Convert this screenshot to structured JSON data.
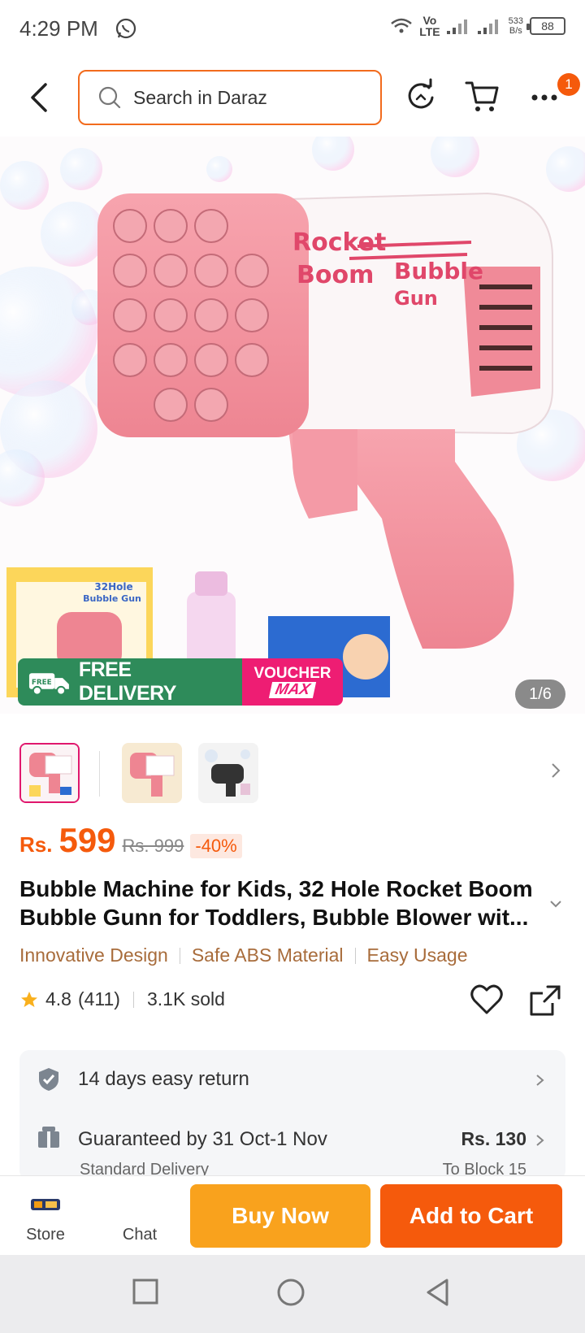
{
  "status_bar": {
    "time": "4:29 PM",
    "network_top": "Vo",
    "network_bottom": "LTE",
    "speed_value": "533",
    "speed_unit": "B/s",
    "battery": "88"
  },
  "top_bar": {
    "search_placeholder": "Search in Daraz",
    "cart_badge": "1"
  },
  "gallery": {
    "counter": "1/6",
    "box_label_1": "32Hole",
    "box_label_2": "Bubble Gun",
    "gun_text_rocket": "Rocket",
    "gun_text_boom": "Boom",
    "gun_text_bubble": "Bubble",
    "gun_text_gun": "Gun",
    "promo_free_tag": "FREE",
    "promo_free_delivery": "FREE DELIVERY",
    "promo_voucher": "VOUCHER",
    "promo_max": "MAX"
  },
  "product": {
    "currency": "Rs.",
    "price": "599",
    "original_price": "Rs. 999",
    "discount": "-40%",
    "title": "Bubble Machine for Kids, 32 Hole Rocket Boom Bubble Gunn for Toddlers, Bubble Blower wit...",
    "tags": [
      "Innovative Design",
      "Safe ABS Material",
      "Easy Usage"
    ],
    "rating": "4.8",
    "rating_count": "(411)",
    "sold": "3.1K sold"
  },
  "service": {
    "return_text": "14 days easy return",
    "delivery_text": "Guaranteed by 31 Oct-1 Nov",
    "delivery_fee": "Rs. 130",
    "delivery_type": "Standard Delivery",
    "delivery_location": "To Block 15"
  },
  "bottom_bar": {
    "store_label": "Store",
    "chat_label": "Chat",
    "buy_now_label": "Buy Now",
    "add_to_cart_label": "Add to Cart"
  },
  "colors": {
    "brand_orange": "#f55a0c",
    "buy_now": "#f9a21d",
    "tag_brown": "#a86c3b",
    "free_delivery_green": "#2e8b5a",
    "voucher_pink": "#ee1d73"
  }
}
